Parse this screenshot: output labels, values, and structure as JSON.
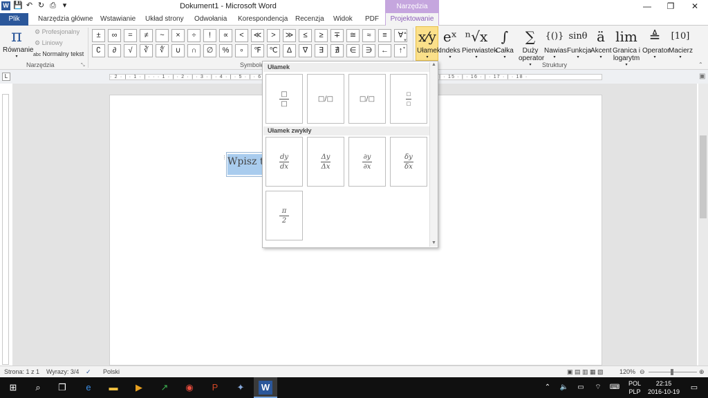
{
  "titlebar": {
    "doc_title": "Dokument1 - Microsoft Word",
    "context_title": "Narzędzia równań",
    "minimize": "—",
    "restore": "❐",
    "close": "✕"
  },
  "tabs": [
    {
      "label": "Plik"
    },
    {
      "label": "Narzędzia główne"
    },
    {
      "label": "Wstawianie"
    },
    {
      "label": "Układ strony"
    },
    {
      "label": "Odwołania"
    },
    {
      "label": "Korespondencja"
    },
    {
      "label": "Recenzja"
    },
    {
      "label": "Widok"
    },
    {
      "label": "PDF"
    },
    {
      "label": "Projektowanie"
    }
  ],
  "ribbon": {
    "tools": {
      "equation_label": "Równanie",
      "professional": "Profesjonalny",
      "linear": "Liniowy",
      "normal_text": "Normalny tekst",
      "group_label": "Narzędzia"
    },
    "symbols": {
      "group_label": "Symbole",
      "row1": [
        "±",
        "∞",
        "=",
        "≠",
        "~",
        "×",
        "÷",
        "!",
        "∝",
        "<",
        "≪",
        ">",
        "≫",
        "≤",
        "≥",
        "∓",
        "≅",
        "≈",
        "≡",
        "∀"
      ],
      "row2": [
        "∁",
        "∂",
        "√",
        "∛",
        "∜",
        "∪",
        "∩",
        "∅",
        "%",
        "∘",
        "℉",
        "℃",
        "∆",
        "∇",
        "∃",
        "∄",
        "∈",
        "∋",
        "←",
        "↑"
      ]
    },
    "structures": {
      "group_label": "Struktury",
      "items": [
        {
          "glyph": "x⁄y",
          "label": "Ułamek"
        },
        {
          "glyph": "eˣ",
          "label": "Indeks"
        },
        {
          "glyph": "ⁿ√x",
          "label": "Pierwiastek"
        },
        {
          "glyph": "∫",
          "label": "Całka"
        },
        {
          "glyph": "∑",
          "label": "Duży operator"
        },
        {
          "glyph": "{()}",
          "label": "Nawias"
        },
        {
          "glyph": "sinθ",
          "label": "Funkcja"
        },
        {
          "glyph": "ä",
          "label": "Akcent"
        },
        {
          "glyph": "lim",
          "label": "Granica i logarytm"
        },
        {
          "glyph": "≜",
          "label": "Operator"
        },
        {
          "glyph": "[10]",
          "label": "Macierz"
        }
      ]
    }
  },
  "ruler": {
    "ticks": "· 2 · | · 1 · | · · · 1 · | · 2 · | · 3 · | · 4 · | · 5 · | · 6 · | · 7 · | · 8 · | · 9 · | · 10 · | · 11 · | · 12 · | · 13 · | · 14 · | · 15 · | · 16 · | · 17 · | · 18 ·"
  },
  "document": {
    "placeholder": "Wpisz tu"
  },
  "gallery": {
    "section1": "Ułamek",
    "section2": "Ułamek zwykły",
    "common": [
      {
        "num": "dy",
        "den": "dx"
      },
      {
        "num": "Δy",
        "den": "Δx"
      },
      {
        "num": "∂y",
        "den": "∂x"
      },
      {
        "num": "δy",
        "den": "δx"
      },
      {
        "num": "π",
        "den": "2"
      }
    ]
  },
  "statusbar": {
    "page": "Strona: 1 z 1",
    "words": "Wyrazy: 3/4",
    "language": "Polski",
    "zoom": "120%"
  },
  "taskbar": {
    "lang1": "POL",
    "lang2": "PLP",
    "time": "22:15",
    "date": "2016-10-19"
  }
}
